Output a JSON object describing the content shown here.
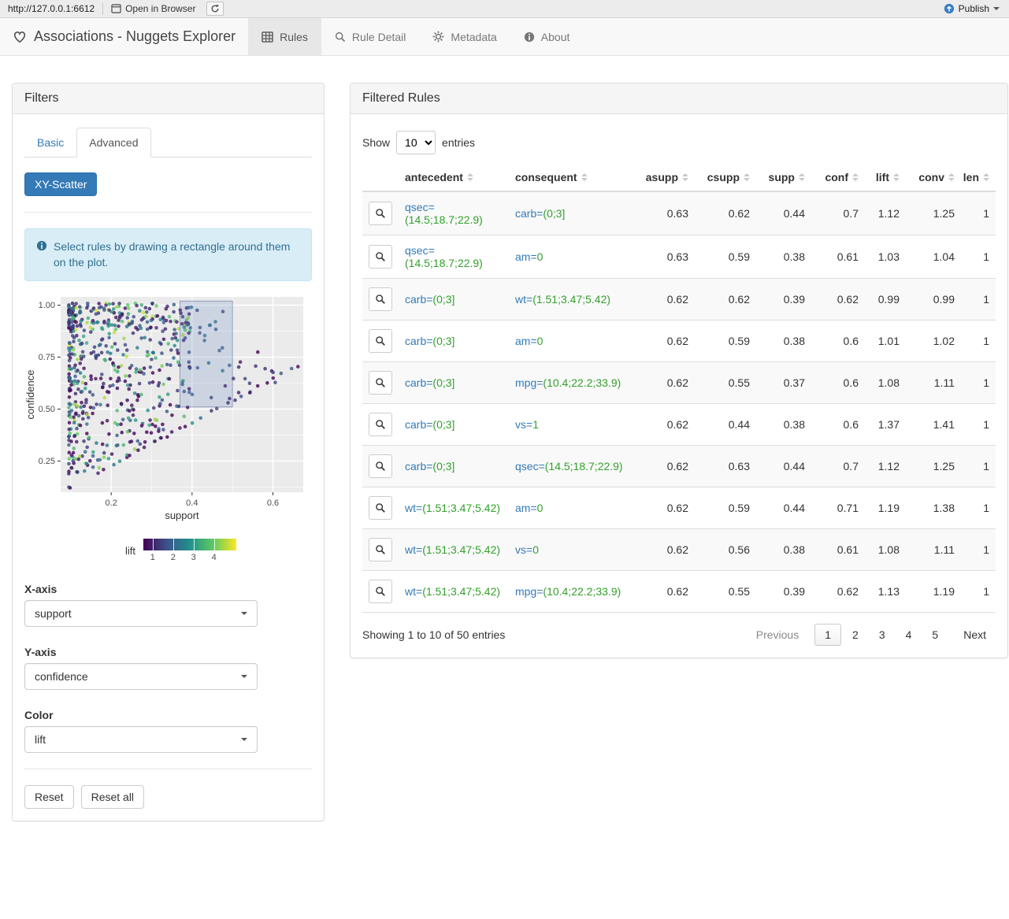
{
  "topbar": {
    "url": "http://127.0.0.1:6612",
    "open_in_browser": "Open in Browser",
    "publish": "Publish"
  },
  "navbar": {
    "brand": "Associations - Nuggets Explorer",
    "tabs": [
      {
        "label": "Rules",
        "active": true
      },
      {
        "label": "Rule Detail",
        "active": false
      },
      {
        "label": "Metadata",
        "active": false
      },
      {
        "label": "About",
        "active": false
      }
    ]
  },
  "filters": {
    "title": "Filters",
    "tab_basic": "Basic",
    "tab_advanced": "Advanced",
    "scatter_button": "XY-Scatter",
    "info_text": "Select rules by drawing a rectangle around them on the plot.",
    "x_axis": {
      "label": "X-axis",
      "value": "support"
    },
    "y_axis": {
      "label": "Y-axis",
      "value": "confidence"
    },
    "color": {
      "label": "Color",
      "value": "lift"
    },
    "reset": "Reset",
    "reset_all": "Reset all"
  },
  "chart_data": {
    "type": "scatter",
    "xlabel": "support",
    "ylabel": "confidence",
    "xlim": [
      0.075,
      0.675
    ],
    "ylim": [
      0.1,
      1.04
    ],
    "x_ticks": [
      {
        "v": 0.2,
        "label": "0.2"
      },
      {
        "v": 0.4,
        "label": "0.4"
      },
      {
        "v": 0.6,
        "label": "0.6"
      }
    ],
    "y_ticks": [
      {
        "v": 0.25,
        "label": "0.25"
      },
      {
        "v": 0.5,
        "label": "0.50"
      },
      {
        "v": 0.75,
        "label": "0.75"
      },
      {
        "v": 1.0,
        "label": "1.00"
      }
    ],
    "x_minor": [
      0.1,
      0.3,
      0.5
    ],
    "y_minor": [
      0.125,
      0.375,
      0.625,
      0.875
    ],
    "grid": true,
    "panel_bg": "#ebebeb",
    "selection_rect": {
      "x0": 0.37,
      "x1": 0.5,
      "y0": 0.51,
      "y1": 1.02
    },
    "points": {
      "n": 560,
      "seed": 42,
      "description": "dense wedge of association rules with confidence >= support, support mostly 0.1-0.4; diagonal streak of points out to support 0.65; colored by lift on viridis scale, most lift near 1"
    },
    "color_legend": {
      "label": "lift",
      "ticks": [
        "1",
        "2",
        "3",
        "4"
      ],
      "tick_positions": [
        0.1,
        0.32,
        0.54,
        0.76
      ],
      "scale": "viridis"
    }
  },
  "rules_table": {
    "title": "Filtered Rules",
    "show_label": "Show",
    "page_length": "10",
    "entries_label": "entries",
    "columns": [
      "antecedent",
      "consequent",
      "asupp",
      "csupp",
      "supp",
      "conf",
      "lift",
      "conv",
      "len"
    ],
    "rows": [
      {
        "ant_attr": "qsec=",
        "ant_val": "(14.5;18.7;22.9)",
        "cons_attr": "carb=",
        "cons_val": "(0;3]",
        "asupp": "0.63",
        "csupp": "0.62",
        "supp": "0.44",
        "conf": "0.7",
        "lift": "1.12",
        "conv": "1.25",
        "len": "1"
      },
      {
        "ant_attr": "qsec=",
        "ant_val": "(14.5;18.7;22.9)",
        "cons_attr": "am=",
        "cons_val": "0",
        "asupp": "0.63",
        "csupp": "0.59",
        "supp": "0.38",
        "conf": "0.61",
        "lift": "1.03",
        "conv": "1.04",
        "len": "1"
      },
      {
        "ant_attr": "carb=",
        "ant_val": "(0;3]",
        "cons_attr": "wt=",
        "cons_val": "(1.51;3.47;5.42)",
        "asupp": "0.62",
        "csupp": "0.62",
        "supp": "0.39",
        "conf": "0.62",
        "lift": "0.99",
        "conv": "0.99",
        "len": "1"
      },
      {
        "ant_attr": "carb=",
        "ant_val": "(0;3]",
        "cons_attr": "am=",
        "cons_val": "0",
        "asupp": "0.62",
        "csupp": "0.59",
        "supp": "0.38",
        "conf": "0.6",
        "lift": "1.01",
        "conv": "1.02",
        "len": "1"
      },
      {
        "ant_attr": "carb=",
        "ant_val": "(0;3]",
        "cons_attr": "mpg=",
        "cons_val": "(10.4;22.2;33.9)",
        "asupp": "0.62",
        "csupp": "0.55",
        "supp": "0.37",
        "conf": "0.6",
        "lift": "1.08",
        "conv": "1.11",
        "len": "1"
      },
      {
        "ant_attr": "carb=",
        "ant_val": "(0;3]",
        "cons_attr": "vs=",
        "cons_val": "1",
        "asupp": "0.62",
        "csupp": "0.44",
        "supp": "0.38",
        "conf": "0.6",
        "lift": "1.37",
        "conv": "1.41",
        "len": "1"
      },
      {
        "ant_attr": "carb=",
        "ant_val": "(0;3]",
        "cons_attr": "qsec=",
        "cons_val": "(14.5;18.7;22.9)",
        "asupp": "0.62",
        "csupp": "0.63",
        "supp": "0.44",
        "conf": "0.7",
        "lift": "1.12",
        "conv": "1.25",
        "len": "1"
      },
      {
        "ant_attr": "wt=",
        "ant_val": "(1.51;3.47;5.42)",
        "cons_attr": "am=",
        "cons_val": "0",
        "asupp": "0.62",
        "csupp": "0.59",
        "supp": "0.44",
        "conf": "0.71",
        "lift": "1.19",
        "conv": "1.38",
        "len": "1"
      },
      {
        "ant_attr": "wt=",
        "ant_val": "(1.51;3.47;5.42)",
        "cons_attr": "vs=",
        "cons_val": "0",
        "asupp": "0.62",
        "csupp": "0.56",
        "supp": "0.38",
        "conf": "0.61",
        "lift": "1.08",
        "conv": "1.11",
        "len": "1"
      },
      {
        "ant_attr": "wt=",
        "ant_val": "(1.51;3.47;5.42)",
        "cons_attr": "mpg=",
        "cons_val": "(10.4;22.2;33.9)",
        "asupp": "0.62",
        "csupp": "0.55",
        "supp": "0.39",
        "conf": "0.62",
        "lift": "1.13",
        "conv": "1.19",
        "len": "1"
      }
    ],
    "info": "Showing 1 to 10 of 50 entries",
    "pagination": {
      "previous": "Previous",
      "pages": [
        "1",
        "2",
        "3",
        "4",
        "5"
      ],
      "active": "1",
      "next": "Next"
    }
  }
}
